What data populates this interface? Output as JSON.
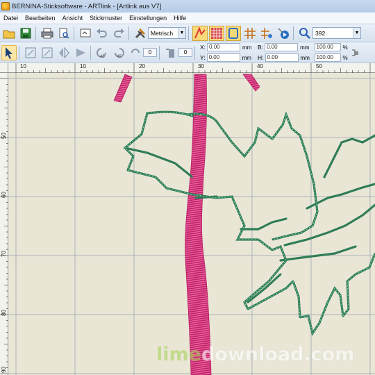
{
  "window": {
    "title": "BERNINA-Sticksoftware - ARTlink - [Artlink aus V7]"
  },
  "menu": [
    "Datei",
    "Bearbeiten",
    "Ansicht",
    "Stickmuster",
    "Einstellungen",
    "Hilfe"
  ],
  "toolbar": {
    "units_select": "Metrisch",
    "zoom_value": "392"
  },
  "properties": {
    "spin_a": "0",
    "spin_b": "0",
    "x_label": "X:",
    "x_value": "0.00",
    "x_unit": "mm",
    "y_label": "Y:",
    "y_value": "0.00",
    "y_unit": "mm",
    "b_label": "B:",
    "b_value": "0.00",
    "b_unit": "mm",
    "h_label": "H:",
    "h_value": "0.00",
    "h_unit": "mm",
    "scale_w": "100.00",
    "scale_w_unit": "%",
    "scale_h": "100.00",
    "scale_h_unit": "%"
  },
  "ruler": {
    "top_labels": [
      "10",
      "10",
      "20",
      "30",
      "40",
      "50"
    ],
    "left_labels": [
      "50",
      "60",
      "70",
      "80",
      "90"
    ]
  },
  "watermark": {
    "lime": "lime",
    "rest": "download.com"
  },
  "colors": {
    "stitch_pink": "#d6307a",
    "stitch_green": "#5fb48a",
    "canvas": "#eae6d6",
    "grid": "#a9b3b8"
  }
}
